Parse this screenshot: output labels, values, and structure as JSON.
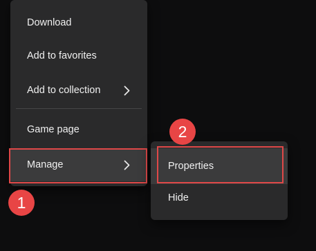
{
  "context_menu": {
    "items": [
      {
        "label": "Download"
      },
      {
        "label": "Add to favorites"
      },
      {
        "label": "Add to collection",
        "icon": "chevron-right-icon"
      },
      {
        "label": "Game page"
      },
      {
        "label": "Manage",
        "icon": "chevron-right-icon"
      }
    ]
  },
  "submenu": {
    "items": [
      {
        "label": "Properties"
      },
      {
        "label": "Hide"
      }
    ]
  },
  "annotations": {
    "badge_1": "1",
    "badge_2": "2",
    "highlight_color": "#e04848",
    "badge_color": "#e84545"
  }
}
